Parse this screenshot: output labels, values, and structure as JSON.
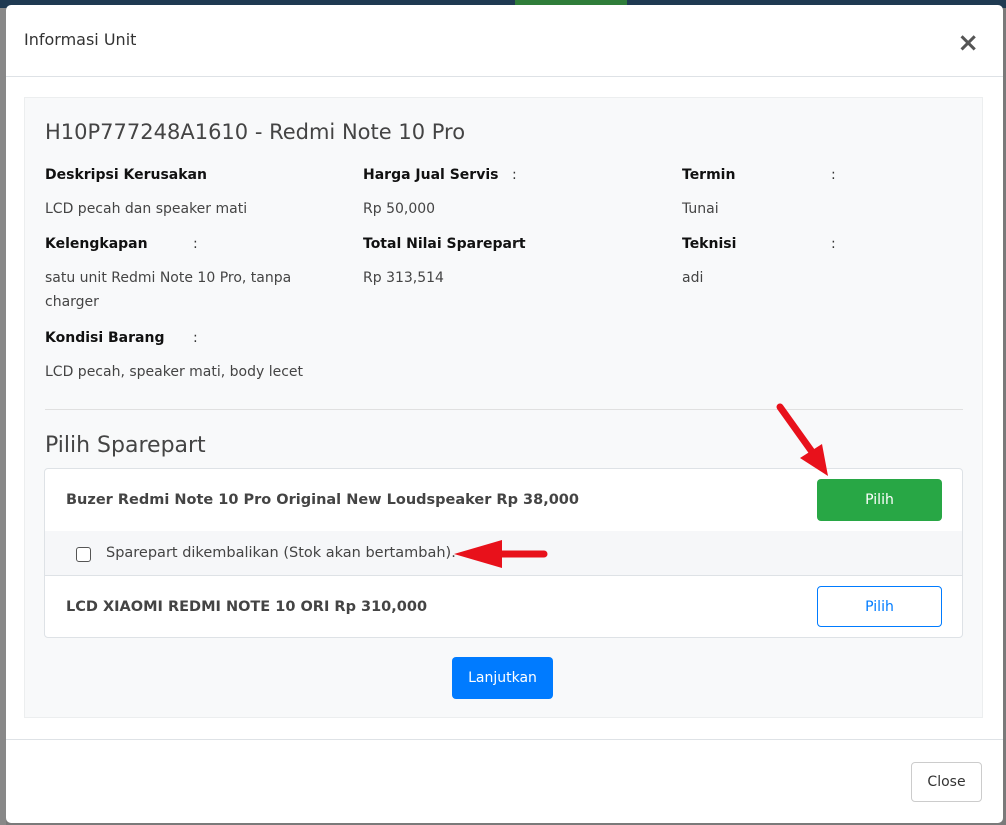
{
  "modal": {
    "title": "Informasi Unit",
    "close_glyph": "×"
  },
  "unit": {
    "title": "H10P777248A1610 - Redmi Note 10 Pro",
    "fields": {
      "deskripsi_label": "Deskripsi Kerusakan",
      "deskripsi_value": "LCD pecah dan speaker mati",
      "harga_label": "Harga Jual Servis",
      "harga_value": "Rp 50,000",
      "termin_label": "Termin",
      "termin_value": "Tunai",
      "kelengkapan_label": "Kelengkapan",
      "kelengkapan_value": "satu unit Redmi Note 10 Pro, tanpa charger",
      "total_label": "Total Nilai Sparepart",
      "total_value": "Rp 313,514",
      "teknisi_label": "Teknisi",
      "teknisi_value": "adi",
      "kondisi_label": "Kondisi Barang",
      "kondisi_value": "LCD pecah, speaker mati, body lecet",
      "colon": ":"
    }
  },
  "sparepart": {
    "section_title": "Pilih Sparepart",
    "items": [
      {
        "name": "Buzer Redmi Note 10 Pro Original New Loudspeaker Rp 38,000",
        "button_label": "Pilih"
      },
      {
        "name": "LCD XIAOMI REDMI NOTE 10 ORI Rp 310,000",
        "button_label": "Pilih"
      }
    ],
    "return_label": "Sparepart dikembalikan (Stok akan bertambah).",
    "return_checked": false,
    "continue_label": "Lanjutkan"
  },
  "footer": {
    "close_label": "Close"
  },
  "colors": {
    "success": "#28a745",
    "primary": "#007bff",
    "annotation_arrow": "#e8111b"
  },
  "icons": {
    "close": "close-icon",
    "arrow_down": "red-arrow-down-icon",
    "arrow_left": "red-arrow-left-icon"
  }
}
